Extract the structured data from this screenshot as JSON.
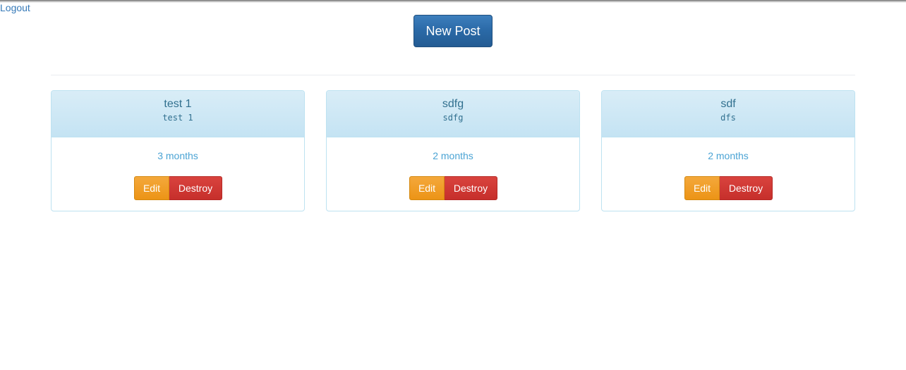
{
  "header": {
    "logout_label": "Logout",
    "new_post_label": "New Post"
  },
  "posts": [
    {
      "title": "test 1",
      "body": "test 1",
      "age": "3 months",
      "edit_label": "Edit",
      "destroy_label": "Destroy"
    },
    {
      "title": "sdfg",
      "body": "sdfg",
      "age": "2 months",
      "edit_label": "Edit",
      "destroy_label": "Destroy"
    },
    {
      "title": "sdf",
      "body": "dfs",
      "age": "2 months",
      "edit_label": "Edit",
      "destroy_label": "Destroy"
    }
  ],
  "colors": {
    "primary": "#2a69a6",
    "warning": "#ec9416",
    "danger": "#c62f2b",
    "info_heading": "#d9edf7",
    "link": "#3579b8"
  }
}
